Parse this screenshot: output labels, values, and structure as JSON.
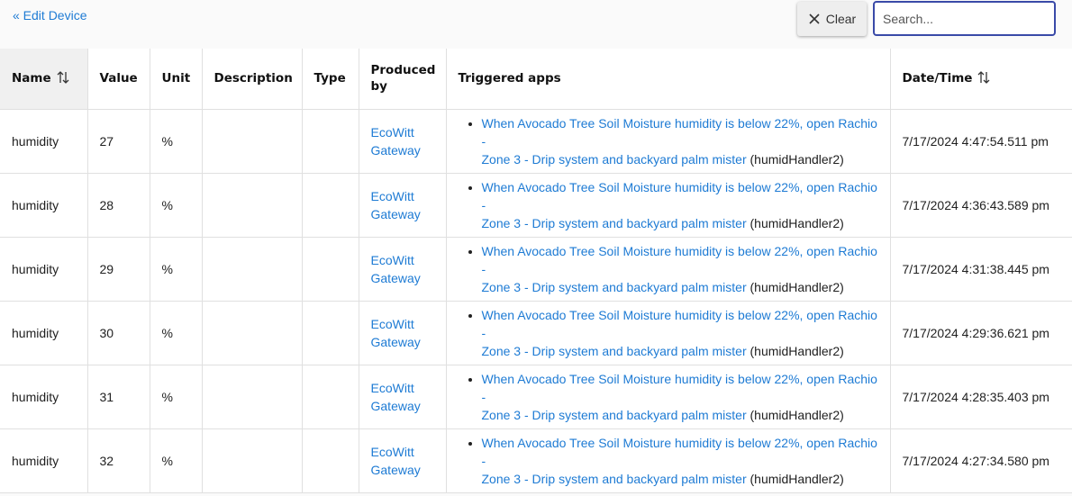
{
  "toolbar": {
    "back_label": "« Edit Device",
    "clear_label": "Clear",
    "search_placeholder": "Search...",
    "search_value": ""
  },
  "columns": {
    "name": "Name",
    "value": "Value",
    "unit": "Unit",
    "description": "Description",
    "type": "Type",
    "produced_by_line1": "Produced",
    "produced_by_line2": "by",
    "triggered_apps": "Triggered apps",
    "datetime": "Date/Time"
  },
  "icons": {
    "sort": "sort-arrows-icon",
    "clear": "close-icon"
  },
  "colors": {
    "link": "#1e7bd4",
    "search_border": "#3a4aa8"
  },
  "rows": [
    {
      "name": "humidity",
      "value": "27",
      "unit": "%",
      "description": "",
      "type": "",
      "producer_line1": "EcoWitt",
      "producer_line2": "Gateway",
      "app_line1": "When Avocado Tree Soil Moisture humidity is below 22%, open Rachio -",
      "app_line2": "Zone 3 - Drip system and backyard palm mister",
      "handler": "(humidHandler2)",
      "datetime": "7/17/2024 4:47:54.511 pm"
    },
    {
      "name": "humidity",
      "value": "28",
      "unit": "%",
      "description": "",
      "type": "",
      "producer_line1": "EcoWitt",
      "producer_line2": "Gateway",
      "app_line1": "When Avocado Tree Soil Moisture humidity is below 22%, open Rachio -",
      "app_line2": "Zone 3 - Drip system and backyard palm mister",
      "handler": "(humidHandler2)",
      "datetime": "7/17/2024 4:36:43.589 pm"
    },
    {
      "name": "humidity",
      "value": "29",
      "unit": "%",
      "description": "",
      "type": "",
      "producer_line1": "EcoWitt",
      "producer_line2": "Gateway",
      "app_line1": "When Avocado Tree Soil Moisture humidity is below 22%, open Rachio -",
      "app_line2": "Zone 3 - Drip system and backyard palm mister",
      "handler": "(humidHandler2)",
      "datetime": "7/17/2024 4:31:38.445 pm"
    },
    {
      "name": "humidity",
      "value": "30",
      "unit": "%",
      "description": "",
      "type": "",
      "producer_line1": "EcoWitt",
      "producer_line2": "Gateway",
      "app_line1": "When Avocado Tree Soil Moisture humidity is below 22%, open Rachio -",
      "app_line2": "Zone 3 - Drip system and backyard palm mister",
      "handler": "(humidHandler2)",
      "datetime": "7/17/2024 4:29:36.621 pm"
    },
    {
      "name": "humidity",
      "value": "31",
      "unit": "%",
      "description": "",
      "type": "",
      "producer_line1": "EcoWitt",
      "producer_line2": "Gateway",
      "app_line1": "When Avocado Tree Soil Moisture humidity is below 22%, open Rachio -",
      "app_line2": "Zone 3 - Drip system and backyard palm mister",
      "handler": "(humidHandler2)",
      "datetime": "7/17/2024 4:28:35.403 pm"
    },
    {
      "name": "humidity",
      "value": "32",
      "unit": "%",
      "description": "",
      "type": "",
      "producer_line1": "EcoWitt",
      "producer_line2": "Gateway",
      "app_line1": "When Avocado Tree Soil Moisture humidity is below 22%, open Rachio -",
      "app_line2": "Zone 3 - Drip system and backyard palm mister",
      "handler": "(humidHandler2)",
      "datetime": "7/17/2024 4:27:34.580 pm"
    }
  ]
}
